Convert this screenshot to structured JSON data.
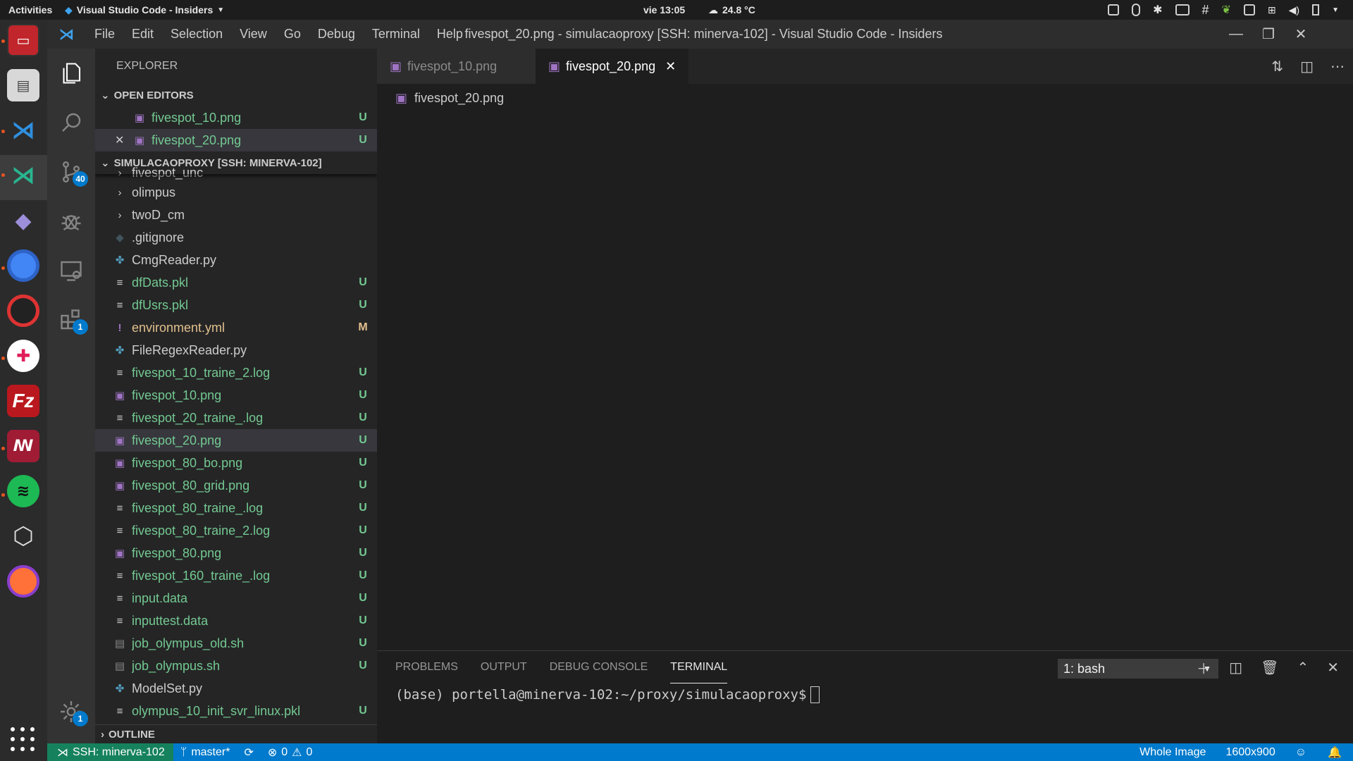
{
  "gnome": {
    "activities": "Activities",
    "app_name": "Visual Studio Code - Insiders",
    "clock": "vie 13:05",
    "weather": "24.8 °C"
  },
  "window": {
    "title": "fivespot_20.png - simulacaoproxy [SSH: minerva-102] - Visual Studio Code - Insiders",
    "menu": [
      "File",
      "Edit",
      "Selection",
      "View",
      "Go",
      "Debug",
      "Terminal",
      "Help"
    ]
  },
  "activity_bar": {
    "scm_badge": "40",
    "extensions_badge": "1",
    "settings_badge": "1"
  },
  "sidebar": {
    "title": "EXPLORER",
    "open_editors_header": "OPEN EDITORS",
    "open_editors": [
      {
        "name": "fivespot_10.png",
        "status": "U"
      },
      {
        "name": "fivespot_20.png",
        "status": "U"
      }
    ],
    "workspace_header": "SIMULACAOPROXY [SSH: MINERVA-102]",
    "partial_folder": "fivespot_unc",
    "folders": [
      "olimpus",
      "twoD_cm"
    ],
    "files": [
      {
        "name": ".gitignore",
        "status": "",
        "icon": "git"
      },
      {
        "name": "CmgReader.py",
        "status": "",
        "icon": "py"
      },
      {
        "name": "dfDats.pkl",
        "status": "U",
        "icon": "txt"
      },
      {
        "name": "dfUsrs.pkl",
        "status": "U",
        "icon": "txt"
      },
      {
        "name": "environment.yml",
        "status": "M",
        "icon": "yml"
      },
      {
        "name": "FileRegexReader.py",
        "status": "",
        "icon": "py"
      },
      {
        "name": "fivespot_10_traine_2.log",
        "status": "U",
        "icon": "txt"
      },
      {
        "name": "fivespot_10.png",
        "status": "U",
        "icon": "img"
      },
      {
        "name": "fivespot_20_traine_.log",
        "status": "U",
        "icon": "txt"
      },
      {
        "name": "fivespot_20.png",
        "status": "U",
        "icon": "img"
      },
      {
        "name": "fivespot_80_bo.png",
        "status": "U",
        "icon": "img"
      },
      {
        "name": "fivespot_80_grid.png",
        "status": "U",
        "icon": "img"
      },
      {
        "name": "fivespot_80_traine_.log",
        "status": "U",
        "icon": "txt"
      },
      {
        "name": "fivespot_80_traine_2.log",
        "status": "U",
        "icon": "txt"
      },
      {
        "name": "fivespot_80.png",
        "status": "U",
        "icon": "img"
      },
      {
        "name": "fivespot_160_traine_.log",
        "status": "U",
        "icon": "txt"
      },
      {
        "name": "input.data",
        "status": "U",
        "icon": "txt"
      },
      {
        "name": "inputtest.data",
        "status": "U",
        "icon": "txt"
      },
      {
        "name": "job_olympus_old.sh",
        "status": "U",
        "icon": "sh"
      },
      {
        "name": "job_olympus.sh",
        "status": "U",
        "icon": "sh"
      },
      {
        "name": "ModelSet.py",
        "status": "",
        "icon": "py"
      },
      {
        "name": "olympus_10_init_svr_linux.pkl",
        "status": "U",
        "icon": "txt"
      }
    ],
    "outline_header": "OUTLINE"
  },
  "editor": {
    "tabs": [
      {
        "label": "fivespot_10.png",
        "active": false
      },
      {
        "label": "fivespot_20.png",
        "active": true
      }
    ],
    "breadcrumb": "fivespot_20.png"
  },
  "panel": {
    "tabs": [
      "PROBLEMS",
      "OUTPUT",
      "DEBUG CONSOLE",
      "TERMINAL"
    ],
    "active_tab": "TERMINAL",
    "terminal_select": "1: bash",
    "prompt": "(base) portella@minerva-102:~/proxy/simulacaoproxy$"
  },
  "statusbar": {
    "remote": "SSH: minerva-102",
    "branch": "master*",
    "errors": "0",
    "warnings": "0",
    "image_mode": "Whole Image",
    "image_size": "1600x900"
  },
  "colors": {
    "accent": "#007acc",
    "remote": "#16825d",
    "untracked": "#73c991",
    "modified": "#e2c08d"
  }
}
